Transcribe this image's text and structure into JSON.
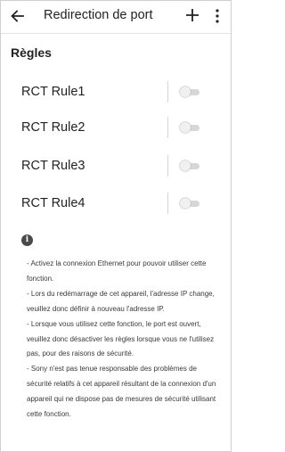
{
  "header": {
    "title": "Redirection de port",
    "back_icon": "arrow-left-icon",
    "add_icon": "plus-icon",
    "more_icon": "more-vert-icon"
  },
  "section": {
    "title": "Règles"
  },
  "rules": [
    {
      "label": "RCT Rule1",
      "enabled": false
    },
    {
      "label": "RCT Rule2",
      "enabled": false
    },
    {
      "label": "RCT Rule3",
      "enabled": false
    },
    {
      "label": "RCT Rule4",
      "enabled": false
    }
  ],
  "info": {
    "icon": "info-icon",
    "glyph": "i",
    "notes": [
      "- Activez la connexion Ethernet pour pouvoir utiliser cette fonction.",
      "- Lors du redémarrage de cet appareil, l'adresse IP change, veuillez donc définir à nouveau l'adresse IP.",
      "- Lorsque vous utilisez cette fonction, le port est ouvert, veuillez donc désactiver les règles lorsque vous ne l'utilisez pas, pour des raisons de sécurité.",
      "- Sony n'est pas tenue responsable des problèmes de sécurité relatifs à cet appareil résultant de la connexion d'un appareil qui ne dispose pas de mesures de sécurité utilisant cette fonction."
    ]
  },
  "colors": {
    "text": "#222222",
    "switch_track_off": "#d7d7d7",
    "switch_thumb_off": "#f0f0f0"
  }
}
